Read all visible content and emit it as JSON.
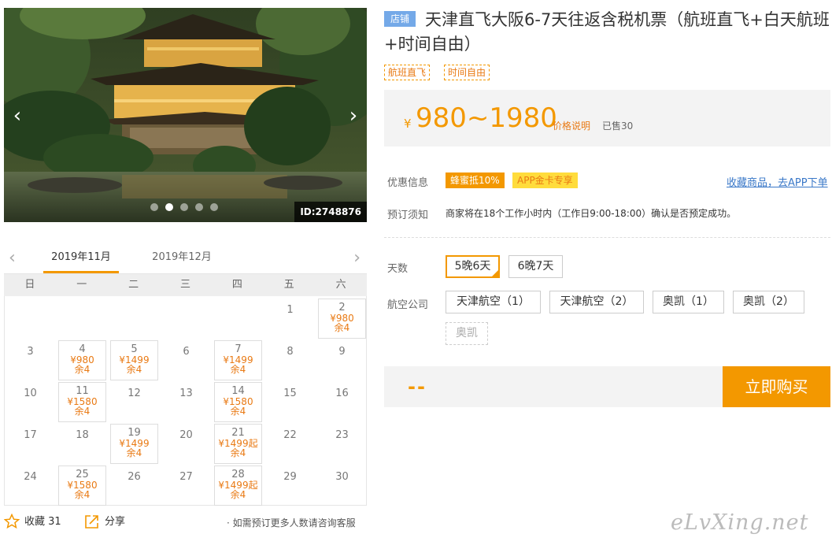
{
  "gallery": {
    "id_label": "ID:2748876",
    "prev_glyph": "‹",
    "next_glyph": "›",
    "dots": 5,
    "active_dot": 1
  },
  "calendar": {
    "prev_glyph": "‹",
    "next_glyph": "›",
    "tabs": [
      "2019年11月",
      "2019年12月"
    ],
    "weekdays": [
      "日",
      "一",
      "二",
      "三",
      "四",
      "五",
      "六"
    ],
    "weeks": [
      [
        null,
        null,
        null,
        null,
        null,
        {
          "day": "1"
        },
        {
          "day": "2",
          "price": "¥980",
          "remain": "余4"
        }
      ],
      [
        {
          "day": "3"
        },
        {
          "day": "4",
          "price": "¥980",
          "remain": "余4"
        },
        {
          "day": "5",
          "price": "¥1499",
          "remain": "余4"
        },
        {
          "day": "6"
        },
        {
          "day": "7",
          "price": "¥1499",
          "remain": "余4"
        },
        {
          "day": "8"
        },
        {
          "day": "9"
        }
      ],
      [
        {
          "day": "10"
        },
        {
          "day": "11",
          "price": "¥1580",
          "remain": "余4"
        },
        {
          "day": "12"
        },
        {
          "day": "13"
        },
        {
          "day": "14",
          "price": "¥1580",
          "remain": "余4"
        },
        {
          "day": "15"
        },
        {
          "day": "16"
        }
      ],
      [
        {
          "day": "17"
        },
        {
          "day": "18"
        },
        {
          "day": "19",
          "price": "¥1499",
          "remain": "余4"
        },
        {
          "day": "20"
        },
        {
          "day": "21",
          "price": "¥1499起",
          "remain": "余4"
        },
        {
          "day": "22"
        },
        {
          "day": "23"
        }
      ],
      [
        {
          "day": "24"
        },
        {
          "day": "25",
          "price": "¥1580",
          "remain": "余4"
        },
        {
          "day": "26"
        },
        {
          "day": "27"
        },
        {
          "day": "28",
          "price": "¥1499起",
          "remain": "余4"
        },
        {
          "day": "29"
        },
        {
          "day": "30"
        }
      ]
    ]
  },
  "footer": {
    "favorite_label": "收藏 31",
    "share_label": "分享",
    "hint": "· 如需预订更多人数请咨询客服"
  },
  "product": {
    "shop_tag": "店铺",
    "title": "天津直飞大阪6-7天往返含税机票（航班直飞+白天航班+时间自由）",
    "features": [
      "航班直飞",
      "时间自由"
    ],
    "currency": "¥",
    "price": "980~1980",
    "price_note": "价格说明",
    "sold": "已售30"
  },
  "promo": {
    "label": "优惠信息",
    "badges": [
      "蜂蜜抵10%",
      "APP金卡专享"
    ],
    "app_link": "收藏商品，去APP下单"
  },
  "notice": {
    "label": "预订须知",
    "text": "商家将在18个工作小时内（工作日9:00-18:00）确认是否预定成功。"
  },
  "options": {
    "days_label": "天数",
    "days": [
      "5晚6天",
      "6晚7天"
    ],
    "days_selected": 0,
    "airline_label": "航空公司",
    "airlines": [
      "天津航空（1）",
      "天津航空（2）",
      "奥凯（1）",
      "奥凯（2）"
    ],
    "airline_disabled": "奥凯"
  },
  "buy": {
    "price_placeholder": "--",
    "button": "立即购买"
  },
  "watermark": "eLvXing.net",
  "colors": {
    "accent": "#f39800",
    "link": "#3a78c8",
    "tag_blue": "#74a9e8"
  }
}
